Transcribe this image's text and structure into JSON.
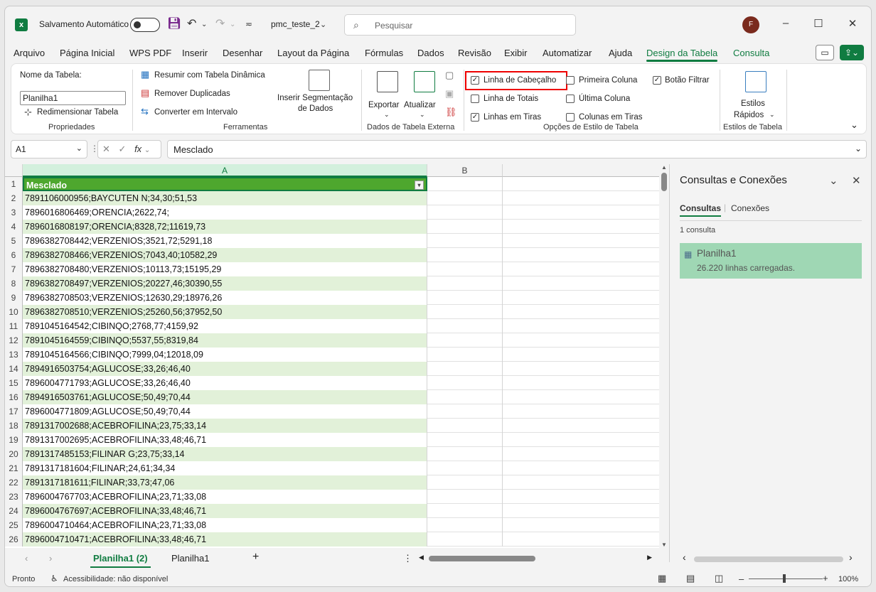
{
  "titlebar": {
    "autosave_label": "Salvamento Automático",
    "filename": "pmc_teste_2",
    "search_placeholder": "Pesquisar",
    "user_initial": "F"
  },
  "tabs": [
    "Arquivo",
    "Página Inicial",
    "WPS PDF",
    "Inserir",
    "Desenhar",
    "Layout da Página",
    "Fórmulas",
    "Dados",
    "Revisão",
    "Exibir",
    "Automatizar",
    "Ajuda",
    "Design da Tabela",
    "Consulta"
  ],
  "active_tab": "Design da Tabela",
  "ribbon": {
    "properties": {
      "table_name_label": "Nome da Tabela:",
      "table_name_value": "Planilha1",
      "resize_label": "Redimensionar Tabela",
      "group": "Propriedades"
    },
    "tools": {
      "pivot_label": "Resumir com Tabela Dinâmica",
      "remove_dupes_label": "Remover Duplicadas",
      "convert_label": "Converter em Intervalo",
      "slicer_label_1": "Inserir Segmentação",
      "slicer_label_2": "de Dados",
      "group": "Ferramentas"
    },
    "external": {
      "export_label": "Exportar",
      "refresh_label": "Atualizar",
      "group": "Dados de Tabela Externa"
    },
    "style_options": {
      "header_row": {
        "label": "Linha de Cabeçalho",
        "checked": true
      },
      "total_row": {
        "label": "Linha de Totais",
        "checked": false
      },
      "banded_rows": {
        "label": "Linhas em Tiras",
        "checked": true
      },
      "first_column": {
        "label": "Primeira Coluna",
        "checked": false
      },
      "last_column": {
        "label": "Última Coluna",
        "checked": false
      },
      "banded_columns": {
        "label": "Colunas em Tiras",
        "checked": false
      },
      "filter_button": {
        "label": "Botão Filtrar",
        "checked": true
      },
      "group": "Opções de Estilo de Tabela"
    },
    "styles": {
      "quick_label_1": "Estilos",
      "quick_label_2": "Rápidos",
      "group": "Estilos de Tabela"
    }
  },
  "formula_bar": {
    "name_box": "A1",
    "fx": "fx",
    "content": "Mesclado"
  },
  "grid": {
    "columns": [
      "A",
      "B"
    ],
    "header": "Mesclado",
    "rows": [
      "7891106000956;BAYCUTEN N;34,30;51,53",
      "7896016806469;ORENCIA;2622,74;",
      "7896016808197;ORENCIA;8328,72;11619,73",
      "7896382708442;VERZENIOS;3521,72;5291,18",
      "7896382708466;VERZENIOS;7043,40;10582,29",
      "7896382708480;VERZENIOS;10113,73;15195,29",
      "7896382708497;VERZENIOS;20227,46;30390,55",
      "7896382708503;VERZENIOS;12630,29;18976,26",
      "7896382708510;VERZENIOS;25260,56;37952,50",
      "7891045164542;CIBINQO;2768,77;4159,92",
      "7891045164559;CIBINQO;5537,55;8319,84",
      "7891045164566;CIBINQO;7999,04;12018,09",
      "7894916503754;AGLUCOSE;33,26;46,40",
      "7896004771793;AGLUCOSE;33,26;46,40",
      "7894916503761;AGLUCOSE;50,49;70,44",
      "7896004771809;AGLUCOSE;50,49;70,44",
      "7891317002688;ACEBROFILINA;23,75;33,14",
      "7891317002695;ACEBROFILINA;33,48;46,71",
      "7891317485153;FILINAR G;23,75;33,14",
      "7891317181604;FILINAR;24,61;34,34",
      "7891317181611;FILINAR;33,73;47,06",
      "7896004767703;ACEBROFILINA;23,71;33,08",
      "7896004767697;ACEBROFILINA;33,48;46,71",
      "7896004710464;ACEBROFILINA;23,71;33,08",
      "7896004710471;ACEBROFILINA;33,48;46,71"
    ]
  },
  "pane": {
    "title": "Consultas e Conexões",
    "tab_queries": "Consultas",
    "tab_connections": "Conexões",
    "count": "1 consulta",
    "query_name": "Planilha1",
    "query_rows": "26.220 linhas carregadas."
  },
  "sheets": [
    "Planilha1 (2)",
    "Planilha1"
  ],
  "active_sheet": "Planilha1 (2)",
  "status": {
    "ready": "Pronto",
    "accessibility": "Acessibilidade: não disponível",
    "zoom": "100%"
  },
  "colors": {
    "accent": "#107c41",
    "header_fill": "#4ea72e",
    "band_fill": "#e2f1d9",
    "highlight": "#ee0000"
  }
}
